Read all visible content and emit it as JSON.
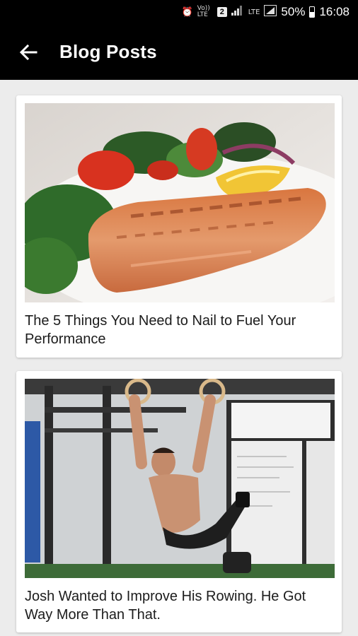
{
  "status_bar": {
    "network_label": "Vo)) LTE",
    "sim_badge": "2",
    "lte_label": "LTE",
    "battery_percent": "50%",
    "time": "16:08"
  },
  "header": {
    "title": "Blog Posts",
    "back_icon": "arrow-left-icon"
  },
  "posts": [
    {
      "title": "The 5 Things You Need to Nail to Fuel Your Performance",
      "image": "salmon-salad-photo"
    },
    {
      "title": "Josh Wanted to Improve His Rowing. He Got Way More Than That.",
      "image": "gym-rings-photo"
    }
  ],
  "colors": {
    "app_bar": "#000000",
    "background": "#ececec",
    "card": "#ffffff",
    "title_text": "#1c1c1c"
  }
}
